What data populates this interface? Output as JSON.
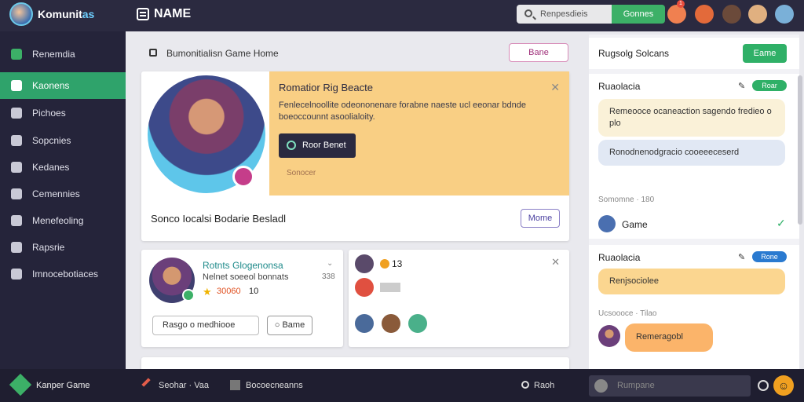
{
  "topbar": {
    "brand_main": "Komunit",
    "brand_accent": "as",
    "name_title": "NAME",
    "search_placeholder": "Renpesdieis",
    "search_button": "Gonnes",
    "notif_count": "1"
  },
  "sidebar": {
    "items": [
      {
        "label": "Renemdia",
        "icon": "diamond-icon"
      },
      {
        "label": "Kaonens",
        "icon": "user-icon"
      },
      {
        "label": "Pichoes",
        "icon": "folder-icon"
      },
      {
        "label": "Sopcnies",
        "icon": "gear-icon"
      },
      {
        "label": "Kedanes",
        "icon": "chat-icon"
      },
      {
        "label": "Cemennies",
        "icon": "wrench-icon"
      },
      {
        "label": "Menefeoling",
        "icon": "doc-icon"
      },
      {
        "label": "Rapsrie",
        "icon": "briefcase-icon"
      },
      {
        "label": "Imnocebotiaces",
        "icon": "cog-icon"
      }
    ]
  },
  "main": {
    "breadcrumb": "Bumonitialisn  Game  Home",
    "top_button": "Bane",
    "hero": {
      "panel_title": "Romatior Rig Beacte",
      "panel_desc": "Fenlecelnoollite odeononenare forabne naeste ucl eeonar bdnde boeoccounnt asoolialoity.",
      "panel_button": "Roor Benet",
      "panel_small": "Sonocer",
      "caption": "Sonco Iocalsi Bodarie Besladl",
      "outline_button": "Mome"
    },
    "profile_card": {
      "title": "Rotnts Glogenonsa",
      "subtitle": "Nelnet soeeol bonnats",
      "count": "338",
      "score": "30060",
      "rank": "10",
      "input_value": "Rasgo o medhiooe",
      "button": "Bame"
    },
    "friends_card": {
      "count": "13"
    }
  },
  "right": {
    "header_title": "Rugsolg Solcans",
    "header_button": "Eame",
    "chat1": {
      "title": "Ruaolacia",
      "badge": "Roar",
      "bubble1": "Remeooce ocaneaction sagendo fredieo o plo",
      "bubble2": "Ronodnenodgracio cooeeeceserd",
      "section": "Somomne · 180",
      "game_label": "Game"
    },
    "chat2": {
      "title": "Ruaolacia",
      "badge": "Rone",
      "bubble1": "Renjsociolee",
      "section": "Ucsoooce · Tilao",
      "bubble2": "Remeragobl"
    }
  },
  "bottombar": {
    "game_label": "Kanper Game",
    "item1": "Seohar · Vaa",
    "item2": "Bocoecneanns",
    "item3": "Raoh",
    "input_placeholder": "Rumpane"
  },
  "colors": {
    "sidebar": "#25243a",
    "accent_green": "#2fa36b",
    "hero_panel": "#f9cf84",
    "accent_blue": "#2a7ad0"
  }
}
